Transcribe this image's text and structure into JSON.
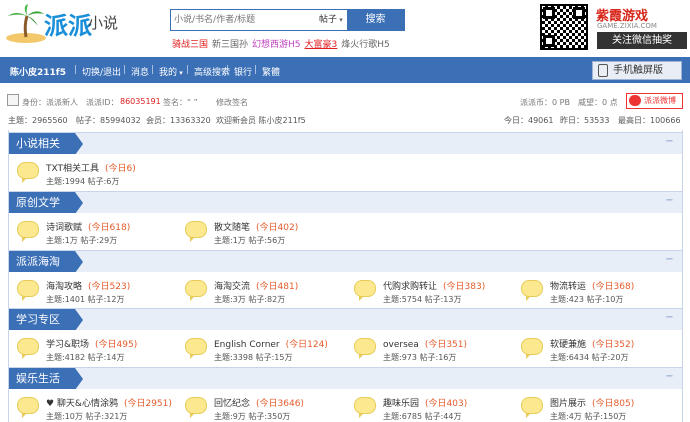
{
  "header": {
    "logo_text": "派派",
    "logo_sub": "小说",
    "search_placeholder": "小说/书名/作者/标题",
    "search_type": "帖子",
    "search_button": "搜索",
    "hot_links": [
      {
        "label": "骑战三国",
        "color": "#e02020"
      },
      {
        "label": "新三国孙",
        "color": "#666666"
      },
      {
        "label": "幻想西游H5",
        "color": "#c040c0"
      },
      {
        "label": "大富豪3",
        "color": "#e02020"
      },
      {
        "label": "烽火行歌H5",
        "color": "#666666"
      }
    ],
    "promo_title": "紫霞游戏",
    "promo_sub": "GAME.ZIXIA.COM",
    "promo_button": "关注微信抽奖"
  },
  "nav": {
    "items": [
      "陈小皮211f5",
      "切换/退出",
      "消息",
      "我的",
      "高级搜索",
      "银行",
      "繁體"
    ],
    "mobile_button": "手机触屏版"
  },
  "user": {
    "identity": "身份：派派新人",
    "id_label": "派派ID：",
    "id_value": "86035191",
    "signature": "签名：“ ”",
    "edit_signature": "修改签名",
    "coins": "派派币：0 PB",
    "prestige": "威望：0 点",
    "weibo": "派派微博"
  },
  "stats": {
    "topics": "主题：2965560",
    "posts": "帖子：85994032",
    "members": "会员：13363320",
    "welcome": "欢迎新会员 陈小皮211f5",
    "today": "今日：49061",
    "yesterday": "昨日：53533",
    "max": "最高日：100666"
  },
  "categories": [
    {
      "title": "小说相关",
      "forums": [
        {
          "name": "TXT相关工具",
          "today": "(今日6)",
          "stats": "主题:1994  帖子:6万"
        }
      ]
    },
    {
      "title": "原创文学",
      "forums": [
        {
          "name": "诗词歌赋",
          "today": "(今日618)",
          "stats": "主题:1万  帖子:29万"
        },
        {
          "name": "散文随笔",
          "today": "(今日402)",
          "stats": "主题:1万  帖子:56万"
        }
      ]
    },
    {
      "title": "派派海淘",
      "forums": [
        {
          "name": "海淘攻略",
          "today": "(今日523)",
          "stats": "主题:1401  帖子:12万"
        },
        {
          "name": "海淘交流",
          "today": "(今日481)",
          "stats": "主题:3万  帖子:82万"
        },
        {
          "name": "代购求购转让",
          "today": "(今日383)",
          "stats": "主题:5754  帖子:13万"
        },
        {
          "name": "物流转运",
          "today": "(今日368)",
          "stats": "主题:423  帖子:10万"
        }
      ]
    },
    {
      "title": "学习专区",
      "forums": [
        {
          "name": "学习&职场",
          "today": "(今日495)",
          "stats": "主题:4182  帖子:14万"
        },
        {
          "name": "English Corner",
          "today": "(今日124)",
          "stats": "主题:3398  帖子:15万"
        },
        {
          "name": "oversea",
          "today": "(今日351)",
          "stats": "主题:973  帖子:16万"
        },
        {
          "name": "软硬兼施",
          "today": "(今日352)",
          "stats": "主题:6434  帖子:20万"
        }
      ]
    },
    {
      "title": "娱乐生活",
      "forums": [
        {
          "name": "♥ 聊天&心情涂鸦",
          "today": "(今日2951)",
          "stats": "主题:10万  帖子:321万"
        },
        {
          "name": "回忆纪念",
          "today": "(今日3646)",
          "stats": "主题:9万  帖子:350万"
        },
        {
          "name": "趣味乐园",
          "today": "(今日403)",
          "stats": "主题:6785  帖子:44万"
        },
        {
          "name": "图片展示",
          "today": "(今日805)",
          "stats": "主题:4万  帖子:150万"
        }
      ]
    }
  ]
}
